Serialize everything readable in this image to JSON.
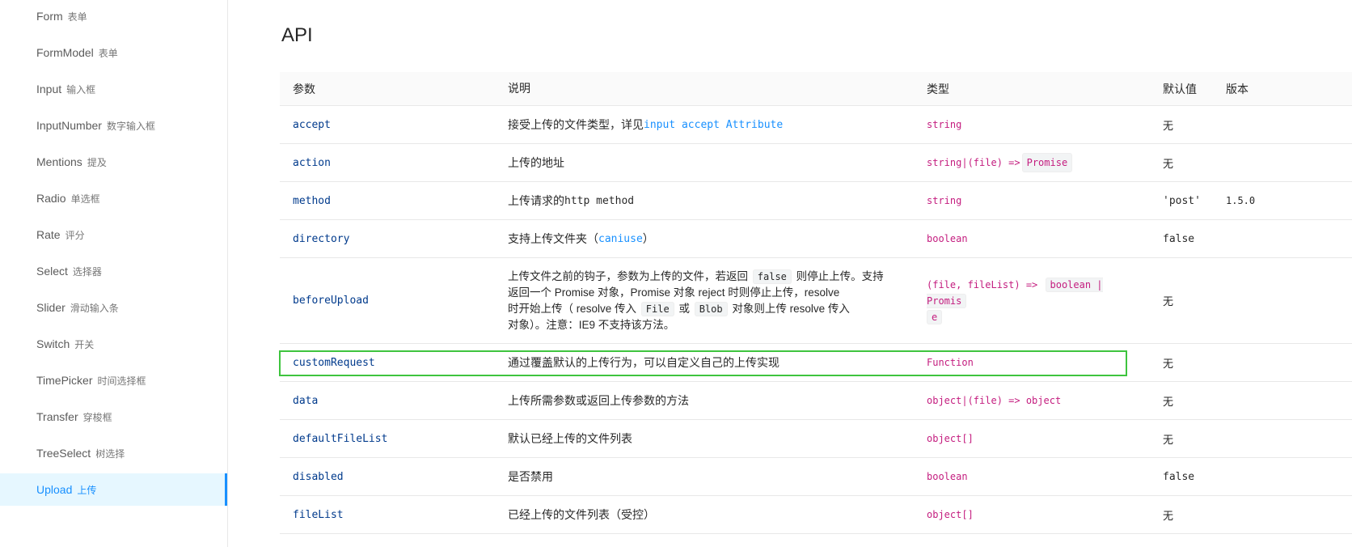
{
  "sidebar": {
    "items": [
      {
        "en": "Form",
        "cn": "表单"
      },
      {
        "en": "FormModel",
        "cn": "表单"
      },
      {
        "en": "Input",
        "cn": "输入框"
      },
      {
        "en": "InputNumber",
        "cn": "数字输入框"
      },
      {
        "en": "Mentions",
        "cn": "提及"
      },
      {
        "en": "Radio",
        "cn": "单选框"
      },
      {
        "en": "Rate",
        "cn": "评分"
      },
      {
        "en": "Select",
        "cn": "选择器"
      },
      {
        "en": "Slider",
        "cn": "滑动输入条"
      },
      {
        "en": "Switch",
        "cn": "开关"
      },
      {
        "en": "TimePicker",
        "cn": "时间选择框"
      },
      {
        "en": "Transfer",
        "cn": "穿梭框"
      },
      {
        "en": "TreeSelect",
        "cn": "树选择"
      },
      {
        "en": "Upload",
        "cn": "上传",
        "active": true
      }
    ]
  },
  "main": {
    "title": "API",
    "headers": {
      "param": "参数",
      "desc": "说明",
      "type": "类型",
      "default": "默认值",
      "version": "版本"
    },
    "rows": [
      {
        "param": "accept",
        "desc_pre": "接受上传的文件类型，详见 ",
        "desc_link": "input accept Attribute",
        "type": "string",
        "default": "无"
      },
      {
        "param": "action",
        "desc": "上传的地址",
        "type": "string|(file) => ",
        "type_code": "Promise",
        "default": "无"
      },
      {
        "param": "method",
        "desc_pre": "上传请求的 ",
        "desc_mono": "http method",
        "type": "string",
        "default": "'post'",
        "version": "1.5.0"
      },
      {
        "param": "directory",
        "desc_pre": "支持上传文件夹（",
        "desc_link": "caniuse",
        "desc_post": "）",
        "type": "boolean",
        "default": "false"
      },
      {
        "param": "beforeUpload",
        "d1": "上传文件之前的钩子，参数为上传的文件，若返回 ",
        "d1_code": "false",
        "d1_post": " 则停止上传。支持",
        "d2": "返回一个 Promise 对象，Promise 对象 reject 时则停止上传，resolve",
        "d3": "时开始上传（ resolve 传入 ",
        "d3_code1": "File",
        "d3_mid": " 或 ",
        "d3_code2": "Blob",
        "d3_post": " 对象则上传 resolve 传入",
        "d4": "对象）。注意：IE9 不支持该方法。",
        "type": "(file, fileList) => ",
        "type_code1": "boolean | Promis",
        "type_code2": "e",
        "default": "无"
      },
      {
        "param": "customRequest",
        "desc": "通过覆盖默认的上传行为，可以自定义自己的上传实现",
        "type": "Function",
        "default": "无"
      },
      {
        "param": "data",
        "desc": "上传所需参数或返回上传参数的方法",
        "type": "object|(file) => object",
        "default": "无"
      },
      {
        "param": "defaultFileList",
        "desc": "默认已经上传的文件列表",
        "type": "object[]",
        "default": "无"
      },
      {
        "param": "disabled",
        "desc": "是否禁用",
        "type": "boolean",
        "default": "false"
      },
      {
        "param": "fileList",
        "desc": "已经上传的文件列表（受控）",
        "type": "object[]",
        "default": "无"
      }
    ]
  }
}
